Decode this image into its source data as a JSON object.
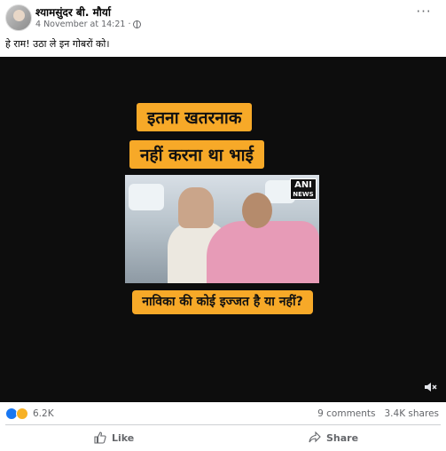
{
  "post": {
    "author": "श्यामसुंदर बी. मौर्या",
    "timestamp": "4 November at 14:21",
    "more_icon": "more-options-icon",
    "caption": "हे राम! उठा ले इन गोबरों को।"
  },
  "video": {
    "title_line1": "इतना खतरनाक",
    "title_line2": "नहीं करना था भाई",
    "logo_text": "ANI",
    "logo_subtext": "NEWS",
    "question_text": "नाविका की कोई इज्जत है या नहीं?",
    "volume_icon": "volume-muted-icon"
  },
  "engagement": {
    "reaction_count": "6.2K",
    "comments": "9 comments",
    "shares": "3.4K shares"
  },
  "actions": {
    "like_label": "Like",
    "share_label": "Share"
  },
  "colors": {
    "accent_overlay": "#f7a928",
    "facebook_blue": "#1877f2"
  }
}
